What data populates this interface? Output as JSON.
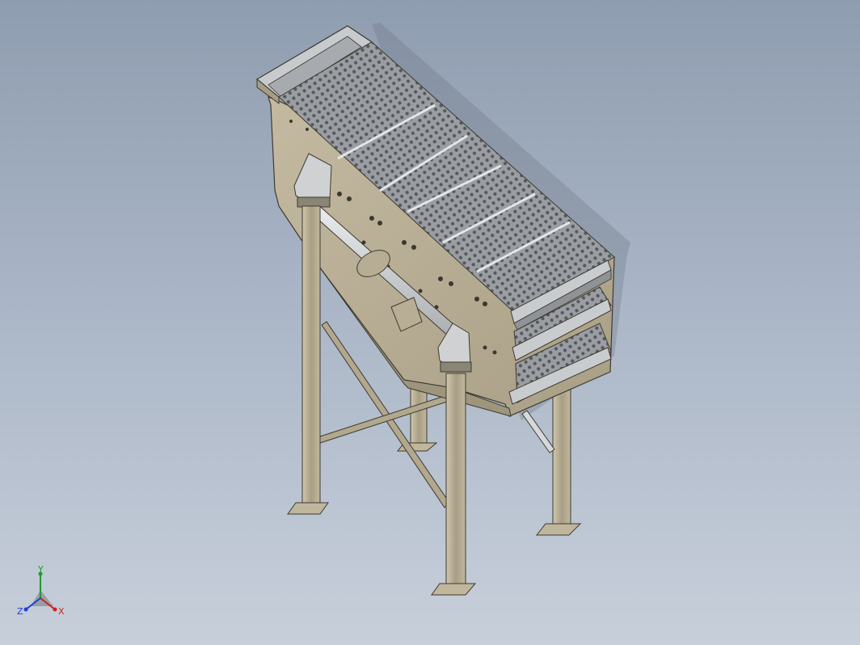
{
  "viewport": {
    "background_top": "#8f9db0",
    "background_bottom": "#c7cfda"
  },
  "model": {
    "body_color": "#b5ab93",
    "frame_color": "#b8ad94",
    "mesh_color": "#8d9096",
    "rail_color": "#d3d6d8"
  },
  "triad": {
    "x_label": "X",
    "y_label": "Y",
    "z_label": "Z",
    "x_color": "#d21f1f",
    "y_color": "#1f9a2a",
    "z_color": "#1f3fd2"
  }
}
